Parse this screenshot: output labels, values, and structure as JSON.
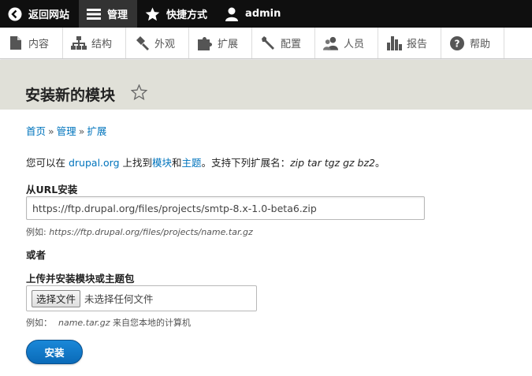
{
  "toolbar": {
    "items": [
      {
        "label": "返回网站",
        "icon": "back-circle-icon"
      },
      {
        "label": "管理",
        "icon": "hamburger-menu-icon"
      },
      {
        "label": "快捷方式",
        "icon": "star-icon"
      },
      {
        "label": "admin",
        "icon": "user-icon"
      }
    ]
  },
  "tray": {
    "items": [
      {
        "label": "内容",
        "icon": "file-icon"
      },
      {
        "label": "结构",
        "icon": "structure-icon"
      },
      {
        "label": "外观",
        "icon": "paintbrush-icon"
      },
      {
        "label": "扩展",
        "icon": "puzzle-icon"
      },
      {
        "label": "配置",
        "icon": "wrench-icon"
      },
      {
        "label": "人员",
        "icon": "people-icon"
      },
      {
        "label": "报告",
        "icon": "bar-chart-icon"
      },
      {
        "label": "帮助",
        "icon": "help-icon"
      }
    ]
  },
  "page": {
    "title": "安装新的模块"
  },
  "breadcrumb": [
    "首页",
    "管理",
    "扩展"
  ],
  "breadcrumb_sep": "»",
  "intro": {
    "prefix": "您可以在 ",
    "link_drupal": "drupal.org",
    "mid1": " 上找到",
    "link_modules": "模块",
    "and": "和",
    "link_themes": "主题",
    "mid2": "。支持下列扩展名：",
    "extensions": "zip tar tgz gz bz2",
    "suffix": "。"
  },
  "url_install": {
    "label": "从URL安装",
    "value": "https://ftp.drupal.org/files/projects/smtp-8.x-1.0-beta6.zip",
    "hint_prefix": "例如: ",
    "hint_example": "https://ftp.drupal.org/files/projects/name.tar.gz"
  },
  "or_label": "或者",
  "upload": {
    "label": "上传并安装模块或主题包",
    "button": "选择文件",
    "status": "未选择任何文件",
    "hint_prefix": "例如：",
    "hint_example": "name.tar.gz",
    "hint_suffix": " 来自您本地的计算机"
  },
  "submit_label": "安装",
  "colors": {
    "toolbar_bg": "#0f0f0f",
    "link": "#0074bd",
    "header_bg": "#e0e0d8",
    "button_primary": "#0a6ab8"
  }
}
